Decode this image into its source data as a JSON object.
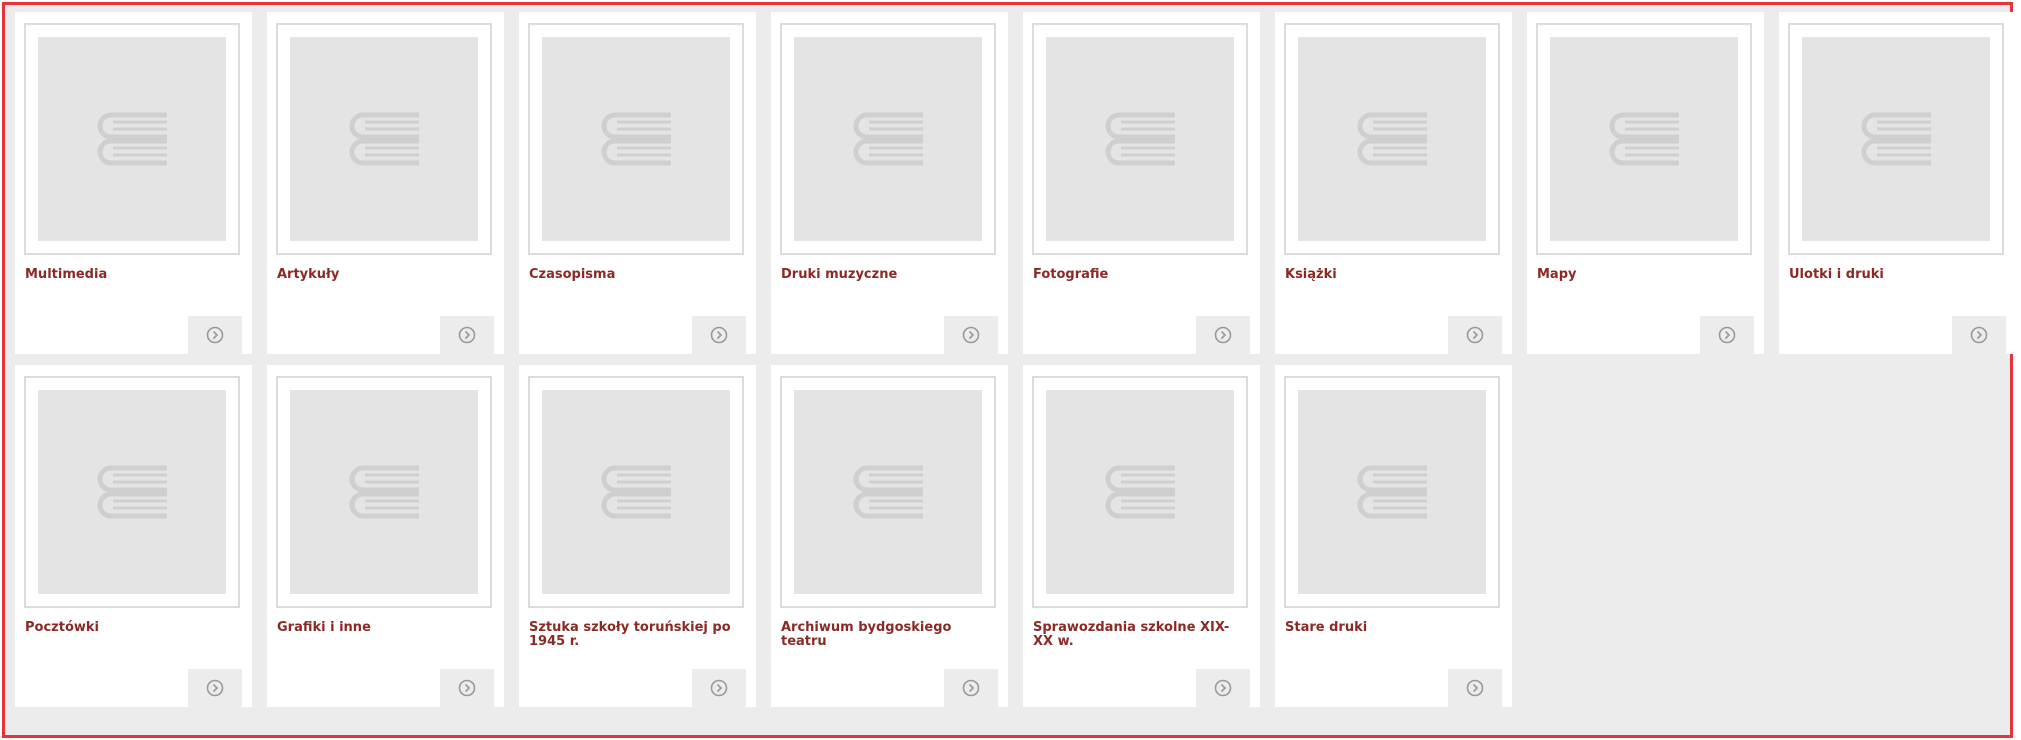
{
  "collections": [
    {
      "label": "Multimedia"
    },
    {
      "label": "Artykuły"
    },
    {
      "label": "Czasopisma"
    },
    {
      "label": "Druki muzyczne"
    },
    {
      "label": "Fotografie"
    },
    {
      "label": "Książki"
    },
    {
      "label": "Mapy"
    },
    {
      "label": "Ulotki i druki"
    },
    {
      "label": "Pocztówki"
    },
    {
      "label": "Grafiki i inne"
    },
    {
      "label": "Sztuka szkoły toruńskiej po 1945 r."
    },
    {
      "label": "Archiwum bydgoskiego teatru"
    },
    {
      "label": "Sprawozdania szkolne XIX-XX w."
    },
    {
      "label": "Stare druki"
    }
  ],
  "icons": {
    "thumbnail": "book-icon",
    "more": "chevron-right-circle-icon"
  },
  "colors": {
    "frame_border": "#e8333b",
    "label_text": "#8b2a24",
    "background": "#ececec"
  }
}
